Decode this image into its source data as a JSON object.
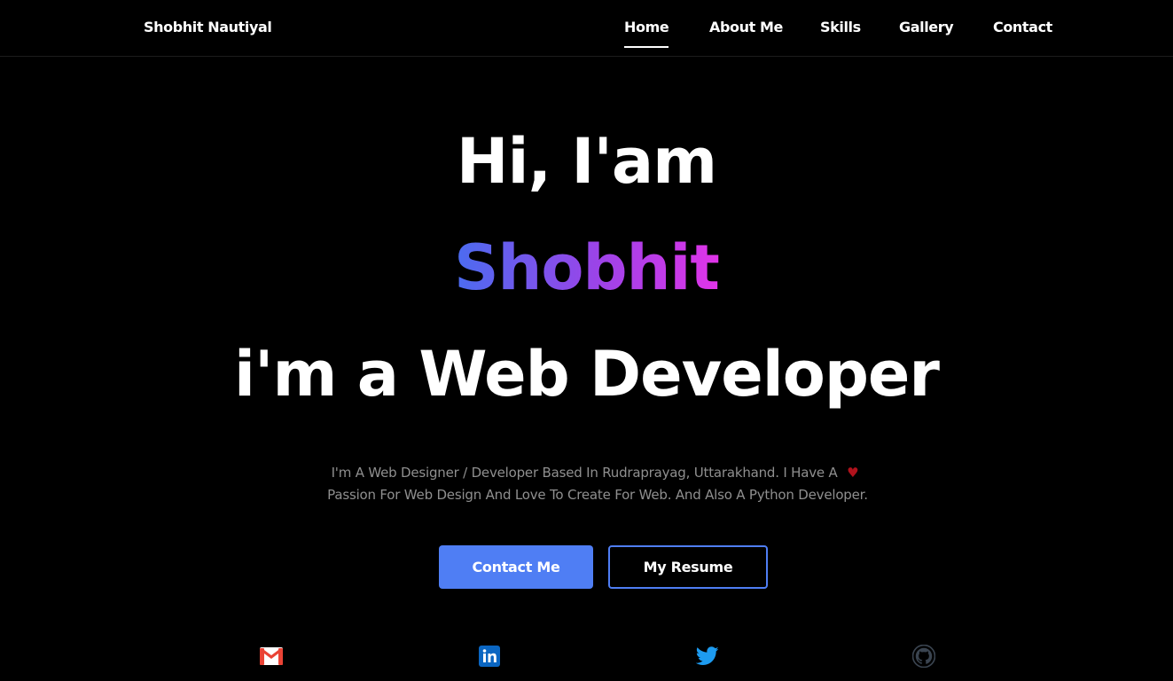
{
  "brand": "Shobhit Nautiyal",
  "nav": {
    "home": "Home",
    "about": "About Me",
    "skills": "Skills",
    "gallery": "Gallery",
    "contact": "Contact",
    "active": "Home"
  },
  "hero": {
    "line1": "Hi, I'am",
    "name": "Shobhit",
    "line3": "i'm a Web Developer"
  },
  "description": {
    "part1": "I'm A Web Designer / Developer Based In Rudraprayag, Uttarakhand. I Have A",
    "heart": "♥",
    "part2": "Passion For Web Design And Love To Create For Web. And Also A Python Developer."
  },
  "buttons": {
    "contact": "Contact Me",
    "resume": "My Resume"
  },
  "social": [
    {
      "name": "gmail-icon",
      "color": "#ea4335"
    },
    {
      "name": "linkedin-icon",
      "color": "#0a66c2"
    },
    {
      "name": "twitter-icon",
      "color": "#1d9bf0"
    },
    {
      "name": "github-icon",
      "color": "#3a4450"
    }
  ],
  "colors": {
    "accent": "#4f7ef4",
    "gradient_start": "#4a6cf0",
    "gradient_end": "#e034e8",
    "muted_text": "#8f8f8f",
    "heart": "#b0121c"
  }
}
